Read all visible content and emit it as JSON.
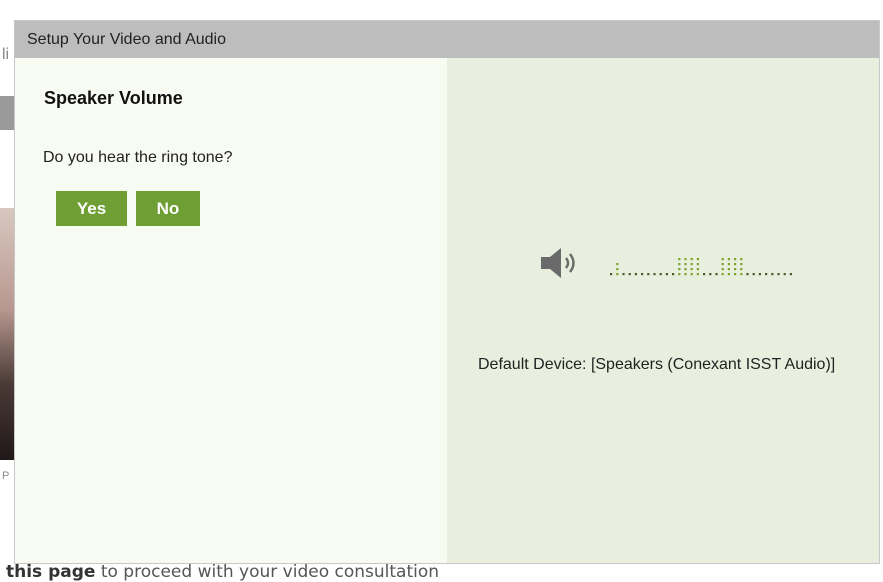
{
  "background": {
    "fragment_top": "li",
    "fragment_mid": "P",
    "bottom_bold": "this page",
    "bottom_rest": " to proceed with your video consultation"
  },
  "dialog": {
    "title": "Setup Your Video and Audio",
    "section_title": "Speaker Volume",
    "question": "Do you hear the ring tone?",
    "yes_label": "Yes",
    "no_label": "No",
    "device_text": "Default Device: [Speakers (Conexant ISST Audio)]",
    "speaker_icon": "speaker-volume-icon",
    "meter_level": 0.35
  },
  "colors": {
    "button": "#6e9e34",
    "header": "#bdbdbd",
    "meter_active": "#7ba428",
    "meter_idle": "#4a5a2a"
  }
}
